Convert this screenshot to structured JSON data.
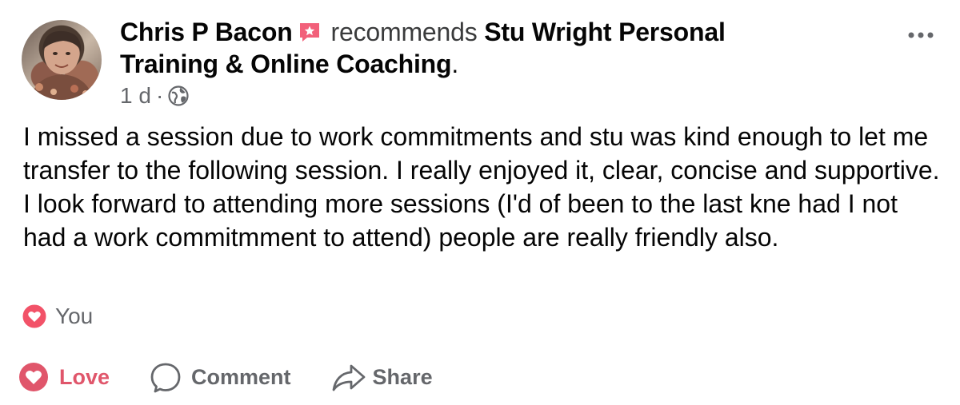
{
  "post": {
    "author": "Chris P Bacon",
    "verb": "recommends",
    "page_name_line1": "Stu Wright Personal",
    "page_name_line2": "Training & Online Coaching",
    "period": ".",
    "time": "1 d",
    "separator": "·",
    "privacy_icon": "globe-icon",
    "more_icon": "more-options-icon",
    "badge_icon": "star-badge-icon",
    "text": "I missed a session due to work commitments and stu was kind enough to let me transfer to the following session. I really enjoyed it, clear, concise and supportive. I look forward to attending more sessions (I'd of been to the last kne had I not had a work commitmment to attend) people are really friendly also."
  },
  "reactions": {
    "icon": "heart-reaction-icon",
    "label": "You"
  },
  "actions": {
    "love": "Love",
    "comment": "Comment",
    "share": "Share"
  },
  "colors": {
    "love_accent": "#e0566b",
    "secondary_text": "#65676b",
    "primary_text": "#050505"
  }
}
